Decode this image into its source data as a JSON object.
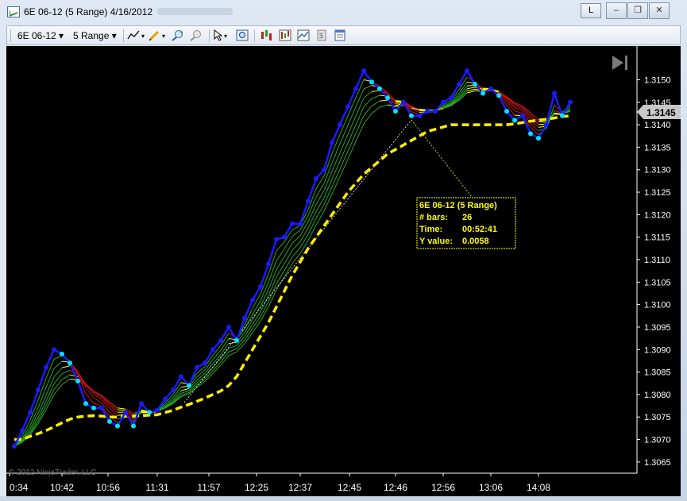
{
  "window": {
    "title": "6E 06-12 (5 Range)  4/16/2012",
    "link_button": "L",
    "minimize": "–",
    "restore": "❐",
    "close": "✕"
  },
  "toolbar": {
    "instrument": "6E 06-12",
    "interval": "5 Range",
    "icons": [
      "draw-line-icon",
      "pencil-icon",
      "zoom-in-icon",
      "zoom-out-icon",
      "pointer-icon",
      "zoom-icon",
      "bar-style-icon",
      "data-series-icon",
      "indicators-icon",
      "strategies-icon",
      "properties-icon"
    ]
  },
  "chart": {
    "copyright": "© 2012 NinjaTrader, LLC",
    "current_price": "1.3145",
    "y_ticks": [
      "1.3150",
      "1.3145",
      "1.3140",
      "1.3135",
      "1.3130",
      "1.3125",
      "1.3120",
      "1.3115",
      "1.3110",
      "1.3105",
      "1.3100",
      "1.3095",
      "1.3090",
      "1.3085",
      "1.3080",
      "1.3075",
      "1.3070",
      "1.3065"
    ],
    "x_ticks": [
      "0:34",
      "10:42",
      "10:56",
      "11:31",
      "11:57",
      "12:25",
      "12:37",
      "12:45",
      "12:46",
      "12:56",
      "13:06",
      "14:08"
    ],
    "tooltip": {
      "line1": "6E 06-12 (5 Range)",
      "bars_label": "# bars:",
      "bars_value": "26",
      "time_label": "Time:",
      "time_value": "00:52:41",
      "y_label": "Y value:",
      "y_value": "0.0058"
    }
  },
  "colors": {
    "price_line": "#1a1aff",
    "cyan_points": "#00e5ff",
    "ribbon_green": "#2aa82a",
    "ribbon_red": "#c81414",
    "ribbon_yellow": "#ffff00",
    "dashed_ma": "#ffef00",
    "tooltip_border": "#ffff00"
  },
  "chart_data": {
    "type": "line",
    "x": [
      0,
      1,
      2,
      3,
      4,
      5,
      6,
      7,
      8,
      9,
      10,
      11,
      12,
      13,
      14,
      15,
      16,
      17,
      18,
      19,
      20,
      21,
      22,
      23,
      24,
      25,
      26,
      27,
      28,
      29,
      30,
      31,
      32,
      33,
      34,
      35,
      36,
      37,
      38,
      39,
      40,
      41,
      42,
      43,
      44,
      45,
      46,
      47,
      48,
      49,
      50,
      51,
      52,
      53,
      54,
      55,
      56,
      57,
      58,
      59,
      60,
      61,
      62,
      63,
      64,
      65,
      66,
      67,
      68,
      69,
      70
    ],
    "series": [
      {
        "values": [
          1.30685,
          1.3072,
          1.3076,
          1.3081,
          1.3086,
          1.309,
          1.3089,
          1.3087,
          1.3083,
          1.3078,
          1.3077,
          1.3077,
          1.3074,
          1.3073,
          1.3076,
          1.3073,
          1.3078,
          1.3076,
          1.30765,
          1.3079,
          1.3081,
          1.3084,
          1.3082,
          1.3086,
          1.3087,
          1.309,
          1.3092,
          1.3095,
          1.3092,
          1.3097,
          1.3101,
          1.3104,
          1.3109,
          1.31145,
          1.3115,
          1.3118,
          1.3118,
          1.3123,
          1.3128,
          1.313,
          1.3136,
          1.314,
          1.3144,
          1.3148,
          1.3152,
          1.31495,
          1.3148,
          1.3146,
          1.3143,
          1.3145,
          1.3142,
          1.3142,
          1.3143,
          1.3143,
          1.3145,
          1.3146,
          1.3149,
          1.3152,
          1.3149,
          1.3147,
          1.3148,
          1.31465,
          1.3143,
          1.3141,
          1.3142,
          1.3138,
          1.3137,
          1.314,
          1.3147,
          1.3142,
          1.3145
        ]
      },
      {
        "values": [
          1.307,
          1.307,
          1.30707,
          1.30713,
          1.3072,
          1.30728,
          1.30737,
          1.30745,
          1.3075,
          1.30752,
          1.30753,
          1.30752,
          1.3075,
          1.3075,
          1.30752,
          1.30752,
          1.30753,
          1.30754,
          1.30755,
          1.3076,
          1.30765,
          1.30772,
          1.30778,
          1.30785,
          1.30792,
          1.308,
          1.30808,
          1.3082,
          1.3084,
          1.3087,
          1.309,
          1.3093,
          1.3096,
          1.30995,
          1.3103,
          1.31065,
          1.31095,
          1.31125,
          1.3115,
          1.31175,
          1.312,
          1.31225,
          1.3125,
          1.3127,
          1.3129,
          1.31305,
          1.3132,
          1.31335,
          1.31345,
          1.31355,
          1.31365,
          1.31375,
          1.31385,
          1.3139,
          1.31395,
          1.314,
          1.314,
          1.314,
          1.314,
          1.314,
          1.314,
          1.314,
          1.314,
          1.31402,
          1.31405,
          1.31408,
          1.3141,
          1.31412,
          1.31415,
          1.31418,
          1.3142
        ]
      }
    ],
    "ylim": [
      1.30625,
      1.31575
    ],
    "grid": false
  }
}
